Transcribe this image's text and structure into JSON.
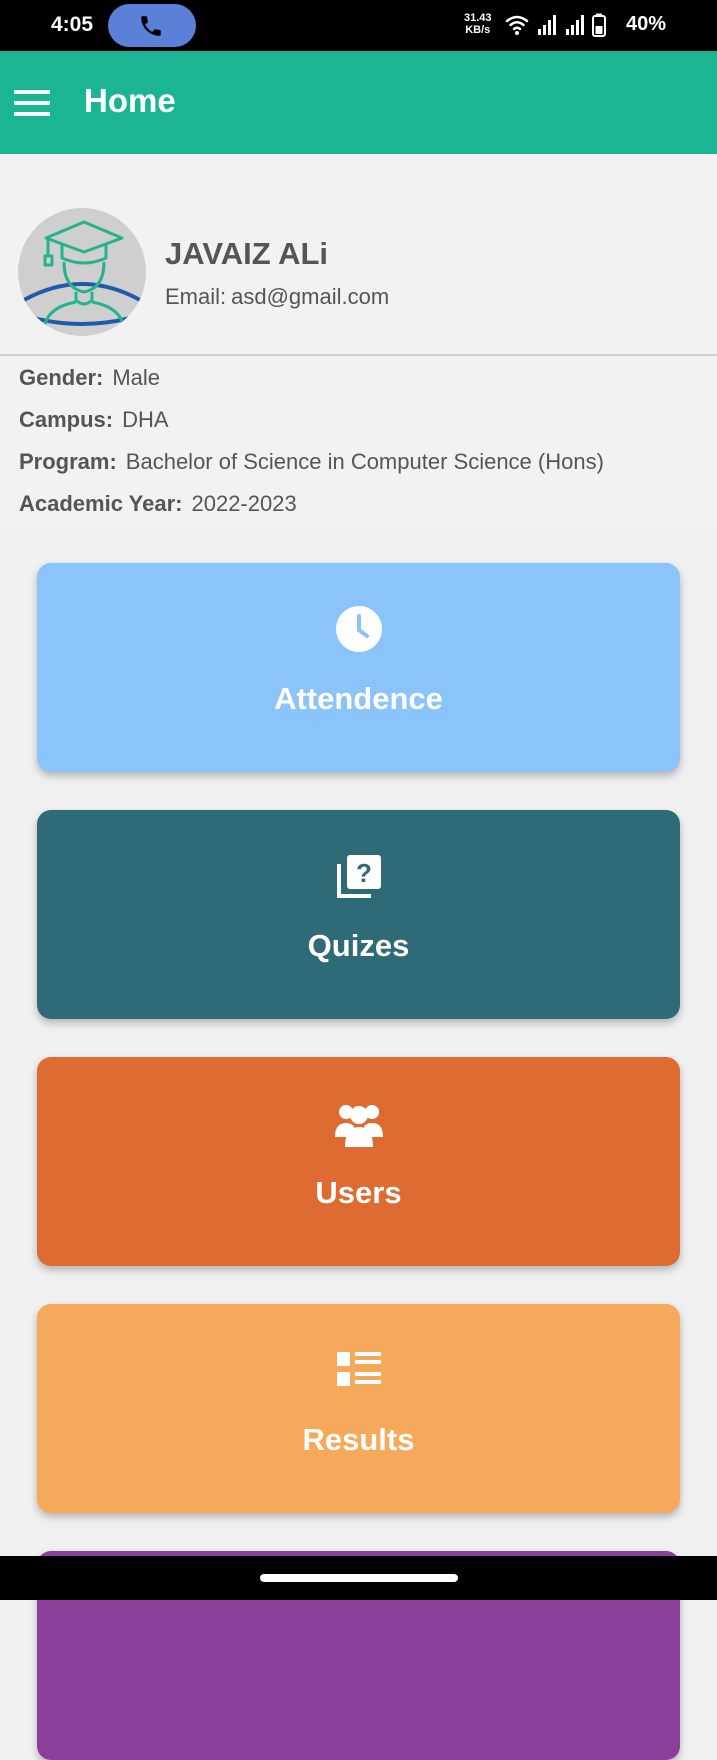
{
  "status_bar": {
    "time": "4:05",
    "speed_value": "31.43",
    "speed_unit": "KB/s",
    "battery": "40%"
  },
  "app_bar": {
    "title": "Home"
  },
  "profile": {
    "name": "JAVAIZ ALi",
    "email_label": "Email:",
    "email": "asd@gmail.com",
    "details": [
      {
        "label": "Gender:",
        "value": "Male"
      },
      {
        "label": "Campus:",
        "value": "DHA"
      },
      {
        "label": "Program:",
        "value": "Bachelor of Science in Computer Science (Hons)"
      },
      {
        "label": "Academic Year:",
        "value": "2022-2023"
      }
    ]
  },
  "tiles": [
    {
      "label": "Attendence",
      "icon": "clock-icon",
      "color": "#8ac4fa"
    },
    {
      "label": "Quizes",
      "icon": "quiz-icon",
      "color": "#2f6a77"
    },
    {
      "label": "Users",
      "icon": "users-icon",
      "color": "#dd6b32"
    },
    {
      "label": "Results",
      "icon": "list-icon",
      "color": "#f6a95a"
    },
    {
      "label": "",
      "icon": "",
      "color": "#8a3f9a"
    }
  ],
  "colors": {
    "app_bar": "#1cb594",
    "status_bar": "#000000",
    "call_pill": "#5b80d8"
  }
}
